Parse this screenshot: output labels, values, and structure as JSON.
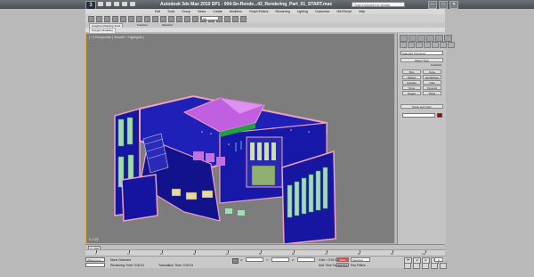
{
  "app": {
    "logo": "3",
    "title": "Autodesk 3ds Max 2010 SP1 - 004-Sn-Rende...43_Rendering_Part_01_START.max",
    "search_placeholder": "Type a keyword or phrase",
    "window_controls": [
      "—",
      "□",
      "✕"
    ]
  },
  "menu": [
    "Edit",
    "Tools",
    "Group",
    "Views",
    "Create",
    "Modifiers",
    "Graph Editors",
    "Rendering",
    "Lighting",
    "Customize",
    "MAXScript",
    "Help"
  ],
  "toolbar": {
    "selection_filter": "All"
  },
  "ribbon": {
    "tabs": [
      "Graphite Modeling Tools",
      "Freeform",
      "Selection"
    ],
    "active_tab": "Graphite Modeling Tools",
    "sub_panel": "Polygon Modeling"
  },
  "viewport": {
    "label": "[ + ] Perspective [ Smooth + Highlights ]",
    "bottom_label": "0 / 100"
  },
  "command_panel": {
    "dropdown": "Standard Primitives",
    "object_type_header": "Object Type",
    "autogrid": "AutoGrid",
    "buttons": [
      "Box",
      "Cone",
      "Sphere",
      "GeoSphere",
      "Cylinder",
      "Tube",
      "Torus",
      "Pyramid",
      "Teapot",
      "Plane"
    ],
    "name_color_header": "Name and Color",
    "swatch_color": "#9a0017"
  },
  "timeline": {
    "frame_label": "0 / 100",
    "ticks": [
      "0",
      "10",
      "20",
      "30",
      "40",
      "50",
      "60",
      "70",
      "80",
      "90",
      "100"
    ]
  },
  "status": {
    "maxscript_label": "Welcome to M",
    "selection": "None Selected",
    "rendering_time": "Rendering Time: 0:00:01",
    "translation_time": "Translation Time: 0:00:01",
    "x_label": "X:",
    "y_label": "Y:",
    "z_label": "Z:",
    "grid": "Grid = 0'10.0\"",
    "auto_key": "Auto Key",
    "set_key": "Set Key",
    "selected_dropdown": "Selected",
    "add_time_tag": "Add Time Tag",
    "key_filters": "Key Filters...",
    "current_frame": "0"
  },
  "colors": {
    "viewport_bg": "#7d7d7d",
    "building_blue": "#1616a0",
    "trim_pink": "#f0a0c0",
    "roof_magenta": "#c060e0",
    "window_green": "#a8d8b0"
  }
}
